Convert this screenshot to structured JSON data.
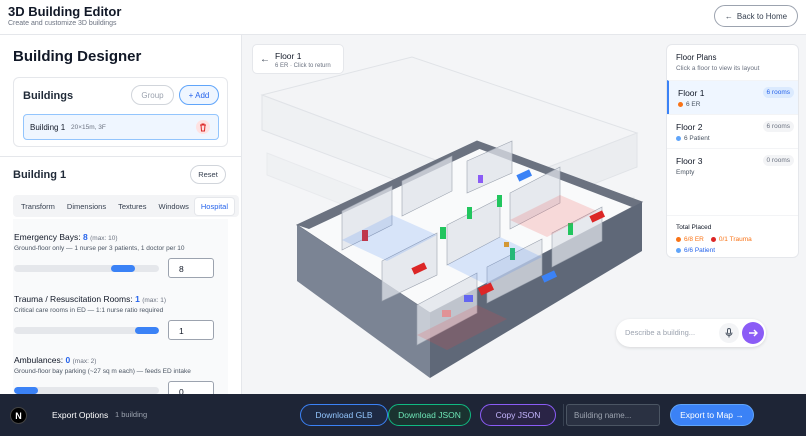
{
  "header": {
    "title": "3D Building Editor",
    "subtitle": "Create and customize 3D buildings",
    "back_button": "Back to Home"
  },
  "left": {
    "designer_title": "Building Designer",
    "buildings_label": "Buildings",
    "group_button": "Group",
    "add_button": "+ Add",
    "building_item": {
      "name": "Building 1",
      "meta": "20×15m, 3F"
    },
    "building_title": "Building 1",
    "reset_button": "Reset",
    "tabs": [
      "Transform",
      "Dimensions",
      "Textures",
      "Windows",
      "Hospital"
    ],
    "active_tab": "Hospital",
    "fields": [
      {
        "title": "Emergency Bays:",
        "value": "8",
        "max": "(max: 10)",
        "desc": "Ground-floor only — 1 nurse per 3 patients, 1 doctor per 10",
        "input": "8",
        "slider_fraction": 0.8
      },
      {
        "title": "Trauma / Resuscitation Rooms:",
        "value": "1",
        "max": "(max: 1)",
        "desc": "Critical care rooms in ED — 1:1 nurse ratio required",
        "input": "1",
        "slider_fraction": 1.0
      },
      {
        "title": "Ambulances:",
        "value": "0",
        "max": "(max: 2)",
        "desc": "Ground-floor bay parking (~27 sq m each) — feeds ED intake",
        "input": "0",
        "slider_fraction": 0.0
      }
    ]
  },
  "viewport": {
    "floor_chip": {
      "title": "Floor 1",
      "sub": "6 ER · Click to return"
    },
    "floor_plans": {
      "title": "Floor Plans",
      "subtitle": "Click a floor to view its layout",
      "floors": [
        {
          "name": "Floor 1",
          "rooms": "6 rooms",
          "detail": "6 ER",
          "dot": "#f97316",
          "active": true
        },
        {
          "name": "Floor 2",
          "rooms": "6 rooms",
          "detail": "6 Patient",
          "dot": "#60a5fa",
          "active": false
        },
        {
          "name": "Floor 3",
          "rooms": "0 rooms",
          "detail": "Empty",
          "dot": "",
          "active": false
        }
      ],
      "total_label": "Total Placed",
      "totals": [
        {
          "text": "6/8 ER",
          "color": "#f97316"
        },
        {
          "text": "0/1 Trauma",
          "color": "#dc2626"
        },
        {
          "text": "6/6 Patient",
          "color": "#60a5fa"
        }
      ]
    },
    "describe_placeholder": "Describe a building..."
  },
  "footer": {
    "export_label": "Export Options",
    "building_count": "1 building",
    "download_glb": "Download GLB",
    "download_json": "Download JSON",
    "copy_json": "Copy JSON",
    "name_placeholder": "Building name...",
    "export_map": "Export to Map →"
  },
  "colors": {
    "accent": "#3b82f6",
    "footer_bg": "#1e2536",
    "slab": "#6b7280",
    "er": "#f97316",
    "trauma": "#dc2626",
    "patient": "#60a5fa",
    "send": "#8b5cf6"
  }
}
